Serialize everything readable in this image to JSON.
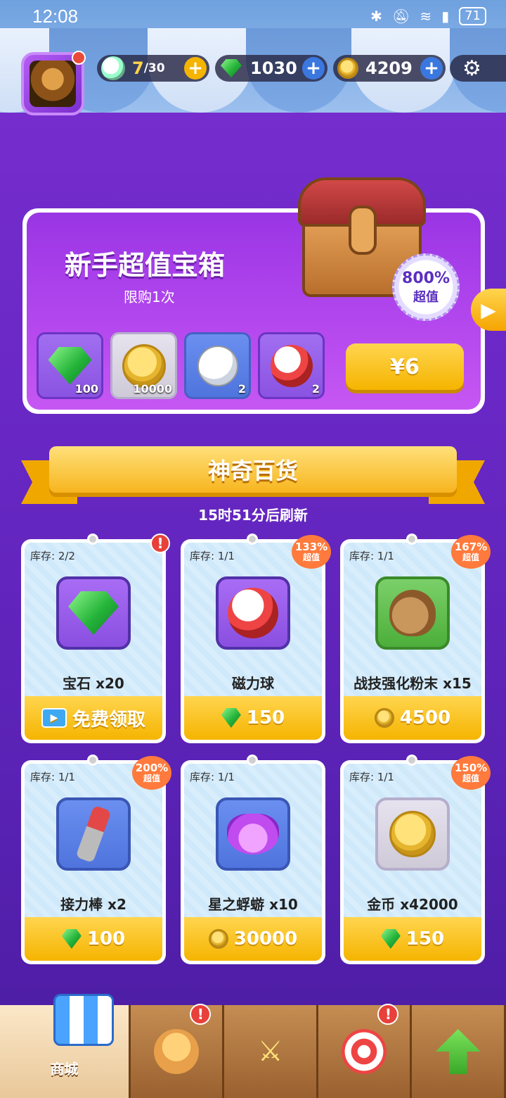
{
  "status_bar": {
    "time": "12:08",
    "battery": "71"
  },
  "resources": {
    "stamina": {
      "value": "7",
      "max": "/30"
    },
    "gems": {
      "value": "1030"
    },
    "coins": {
      "value": "4209"
    }
  },
  "starter_pack": {
    "title": "新手超值宝箱",
    "limit": "限购1次",
    "value_percent": "800%",
    "value_label": "超值",
    "items": [
      {
        "icon": "gem-icon",
        "qty": "100"
      },
      {
        "icon": "coin-icon",
        "qty": "10000"
      },
      {
        "icon": "white-ball-icon",
        "qty": "2"
      },
      {
        "icon": "magnet-ball-icon",
        "qty": "2"
      }
    ],
    "price": "¥6"
  },
  "shop": {
    "title": "神奇百货",
    "refresh": "15时51分后刷新",
    "items": [
      {
        "stock": "库存: 2/2",
        "name": "宝石 x20",
        "price": "免费领取",
        "currency": "video",
        "badge": null,
        "alert": "!"
      },
      {
        "stock": "库存: 1/1",
        "name": "磁力球",
        "price": "150",
        "currency": "gem",
        "badge": {
          "percent": "133%",
          "label": "超值"
        }
      },
      {
        "stock": "库存: 1/1",
        "name": "战技强化粉末 x15",
        "price": "4500",
        "currency": "coin",
        "badge": {
          "percent": "167%",
          "label": "超值"
        }
      },
      {
        "stock": "库存: 1/1",
        "name": "接力棒 x2",
        "price": "100",
        "currency": "gem",
        "badge": {
          "percent": "200%",
          "label": "超值"
        }
      },
      {
        "stock": "库存: 1/1",
        "name": "星之蜉蝣 x10",
        "price": "30000",
        "currency": "coin",
        "badge": null
      },
      {
        "stock": "库存: 1/1",
        "name": "金币 x42000",
        "price": "150",
        "currency": "gem",
        "badge": {
          "percent": "150%",
          "label": "超值"
        }
      }
    ]
  },
  "nav": {
    "shop_label": "商城",
    "alerts": [
      "!",
      "!"
    ]
  },
  "colors": {
    "background": "#6a28c6",
    "accent_yellow": "#f5b400",
    "alert_red": "#e8403a"
  }
}
